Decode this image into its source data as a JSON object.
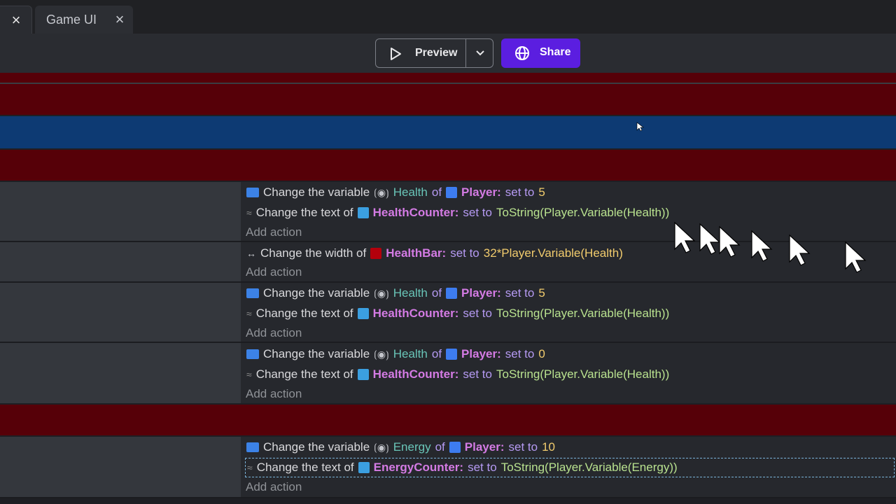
{
  "tabs": [
    {
      "label": ""
    },
    {
      "label": "Game UI"
    }
  ],
  "toolbar": {
    "preview_label": "Preview",
    "share_label": "Share"
  },
  "events": [
    {
      "actions": [
        {
          "type": "variable",
          "verb": "Change the variable",
          "var": "Health",
          "of": "of",
          "object": "Player:",
          "set": "set to",
          "value": "5"
        },
        {
          "type": "text",
          "verb": "Change the text of",
          "object": "HealthCounter:",
          "set": "set to",
          "value": "ToString(Player.Variable(Health))"
        }
      ],
      "add_action": "Add action"
    },
    {
      "actions": [
        {
          "type": "width",
          "verb": "Change the width of",
          "object": "HealthBar:",
          "set": "set to",
          "value": "32*Player.Variable(Health)"
        }
      ],
      "add_action": "Add action"
    },
    {
      "actions": [
        {
          "type": "variable",
          "verb": "Change the variable",
          "var": "Health",
          "of": "of",
          "object": "Player:",
          "set": "set to",
          "value": "5"
        },
        {
          "type": "text",
          "verb": "Change the text of",
          "object": "HealthCounter:",
          "set": "set to",
          "value": "ToString(Player.Variable(Health))"
        }
      ],
      "add_action": "Add action"
    },
    {
      "actions": [
        {
          "type": "variable",
          "verb": "Change the variable",
          "var": "Health",
          "of": "of",
          "object": "Player:",
          "set": "set to",
          "value": "0"
        },
        {
          "type": "text",
          "verb": "Change the text of",
          "object": "HealthCounter:",
          "set": "set to",
          "value": "ToString(Player.Variable(Health))"
        }
      ],
      "add_action": "Add action"
    },
    {
      "actions": [
        {
          "type": "variable",
          "verb": "Change the variable",
          "var": "Energy",
          "of": "of",
          "object": "Player:",
          "set": "set to",
          "value": "10"
        },
        {
          "type": "text",
          "verb": "Change the text of",
          "object": "EnergyCounter:",
          "set": "set to",
          "value": "ToString(Player.Variable(Energy))"
        }
      ],
      "add_action": "Add action"
    }
  ],
  "colors": {
    "accent": "#5b1ee0",
    "group_red": "#560008",
    "group_blue": "#0d3a73"
  }
}
